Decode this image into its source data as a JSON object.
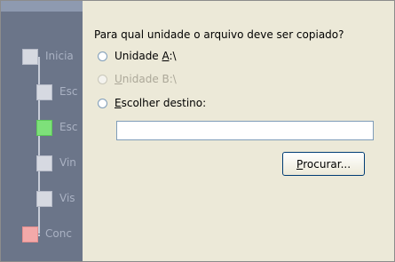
{
  "wizard": {
    "steps": [
      {
        "label": "Inicia",
        "state": "done"
      },
      {
        "label": "Esc",
        "state": "done"
      },
      {
        "label": "Esc",
        "state": "current"
      },
      {
        "label": "Vin",
        "state": "pending"
      },
      {
        "label": "Vis",
        "state": "pending"
      },
      {
        "label": "Conc",
        "state": "finish"
      }
    ]
  },
  "content": {
    "question": "Para qual unidade o arquivo deve ser copiado?",
    "options": [
      {
        "before": "Unidade ",
        "accel": "A",
        "after": ":\\",
        "enabled": true
      },
      {
        "before": "",
        "accel": "U",
        "after": "nidade B:\\",
        "enabled": false
      },
      {
        "before": "",
        "accel": "E",
        "after": "scolher destino:",
        "enabled": true
      }
    ],
    "destination_value": "",
    "browse_button": {
      "accel": "P",
      "rest": "rocurar..."
    }
  }
}
